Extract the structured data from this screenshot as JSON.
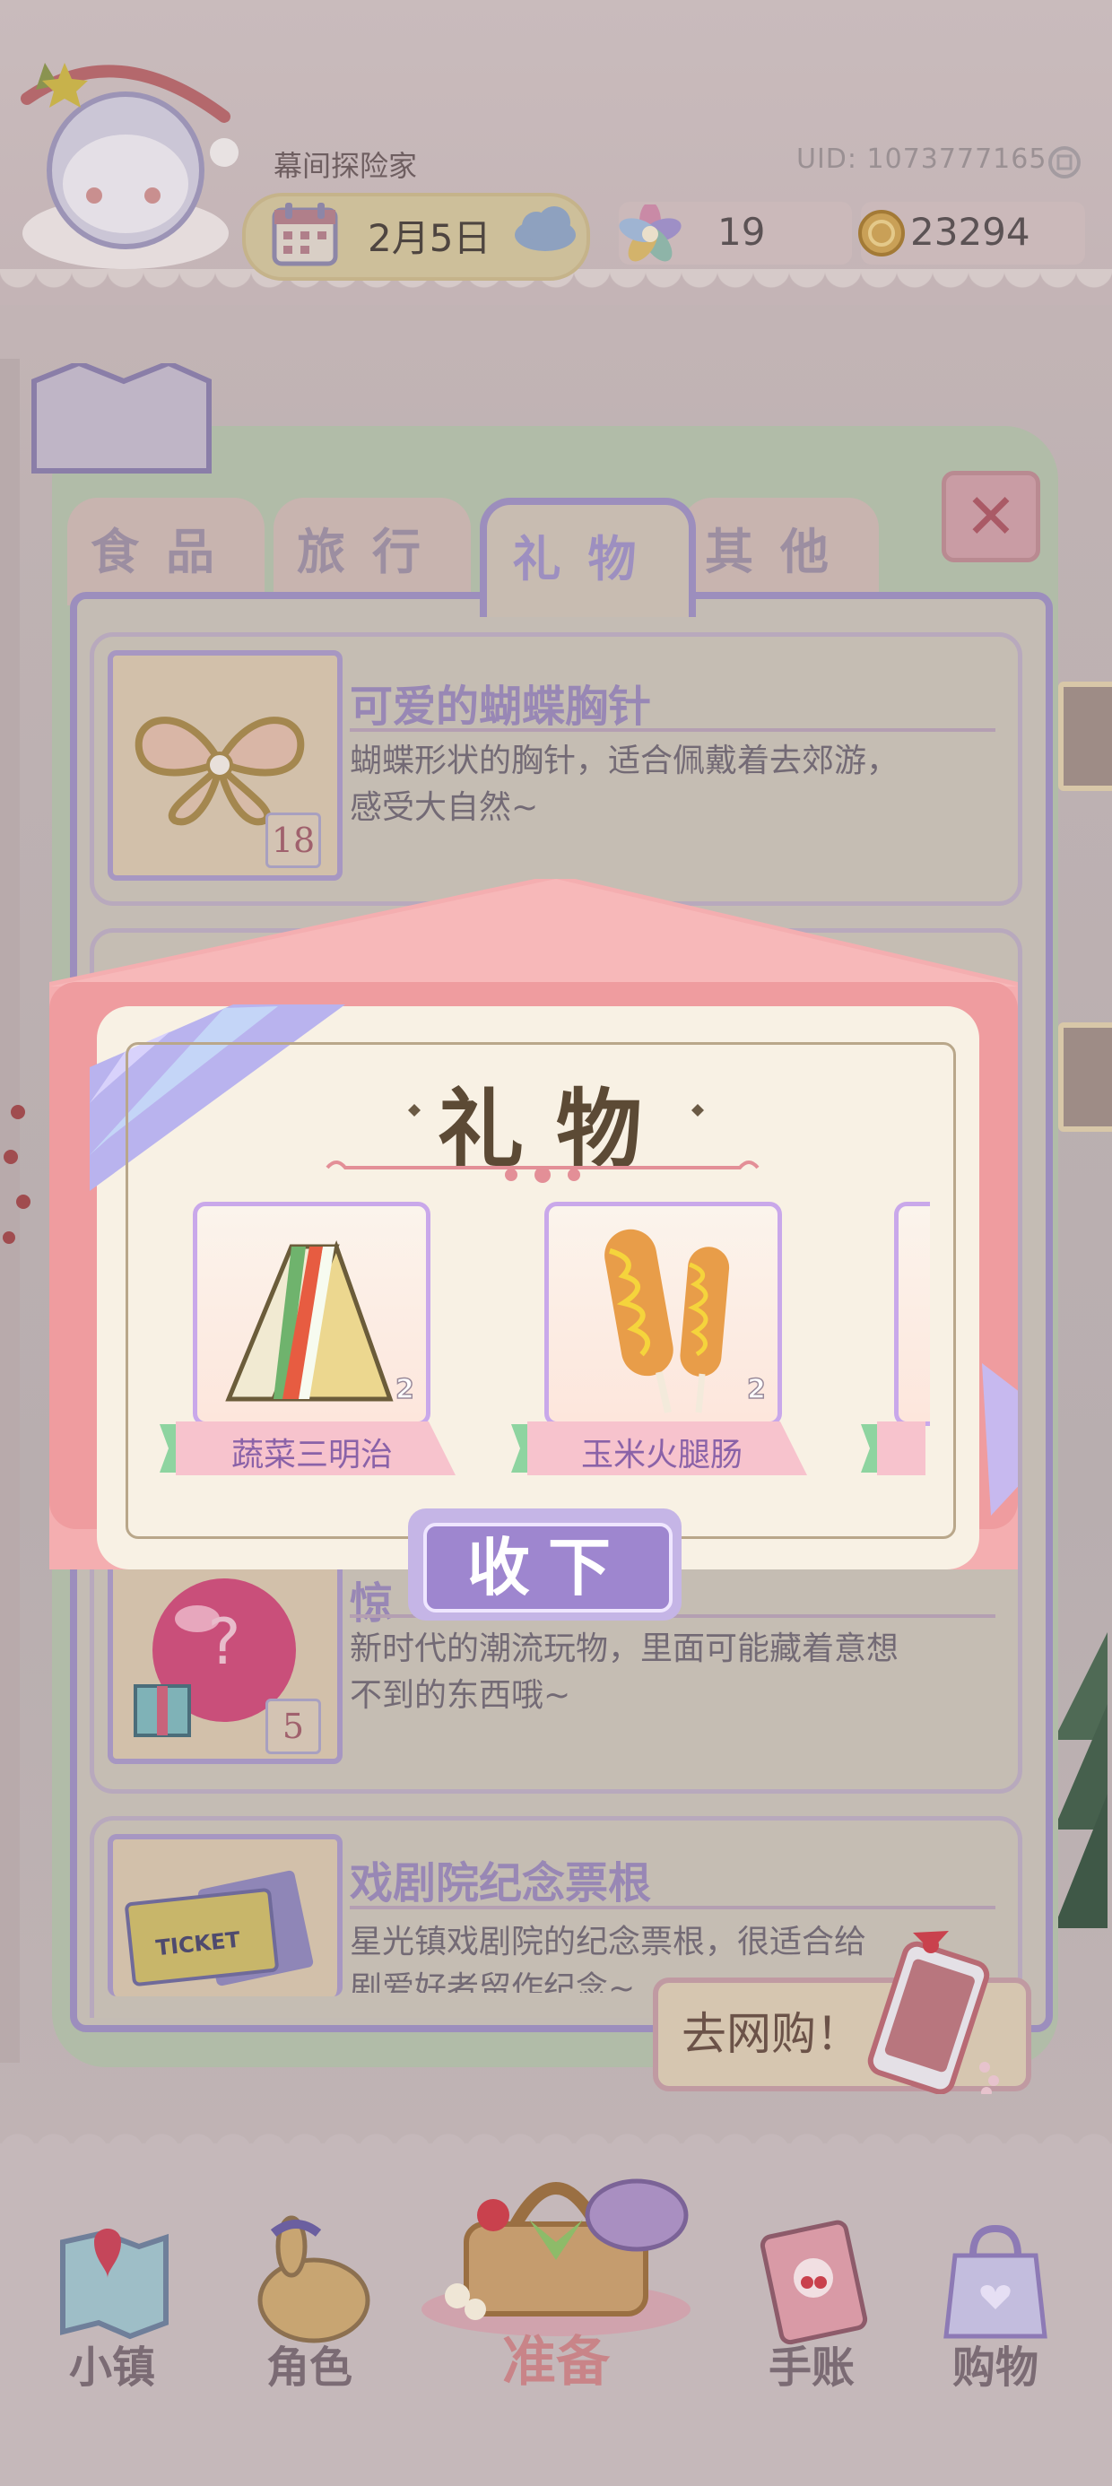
{
  "header": {
    "player_name": "幕间探险家",
    "uid": "UID: 1073777165",
    "date": "2月5日",
    "flower_count": "19",
    "coin_count": "23294"
  },
  "tabs": [
    {
      "label": "食品",
      "active": false
    },
    {
      "label": "旅行",
      "active": false
    },
    {
      "label": "礼物",
      "active": true
    },
    {
      "label": "其他",
      "active": false
    }
  ],
  "items": [
    {
      "title": "可爱的蝴蝶胸针",
      "desc_line1": "蝴蝶形状的胸针，适合佩戴着去郊游，",
      "desc_line2": "感受大自然~",
      "qty": "18",
      "icon": "butterfly-brooch-icon"
    },
    {
      "title": "惊",
      "desc_line1": "新时代的潮流玩物，里面可能藏着意想",
      "desc_line2": "不到的东西哦~",
      "qty": "5",
      "icon": "gachapon-ball-icon"
    },
    {
      "title": "戏剧院纪念票根",
      "desc_line1": "星光镇戏剧院的纪念票根，很适合给",
      "desc_line2": "剧爱好者留作纪念~",
      "qty": "",
      "icon": "ticket-stub-icon"
    }
  ],
  "shop_button": {
    "label": "去网购！"
  },
  "gift_popup": {
    "title": "礼物",
    "gifts": [
      {
        "name": "蔬菜三明治",
        "count": "2",
        "icon": "sandwich-icon"
      },
      {
        "name": "玉米火腿肠",
        "count": "2",
        "icon": "corn-dog-icon"
      }
    ],
    "collect_label": "收下"
  },
  "nav": [
    {
      "label": "小镇",
      "icon": "town-map-icon"
    },
    {
      "label": "角色",
      "icon": "character-bunny-icon"
    },
    {
      "label": "准备",
      "icon": "picnic-basket-icon"
    },
    {
      "label": "手账",
      "icon": "journal-icon"
    },
    {
      "label": "购物",
      "icon": "shopping-bag-icon"
    }
  ],
  "colors": {
    "accent_purple": "#9e86cf",
    "panel_green": "#b1bca8",
    "pink": "#f4a9ab"
  }
}
